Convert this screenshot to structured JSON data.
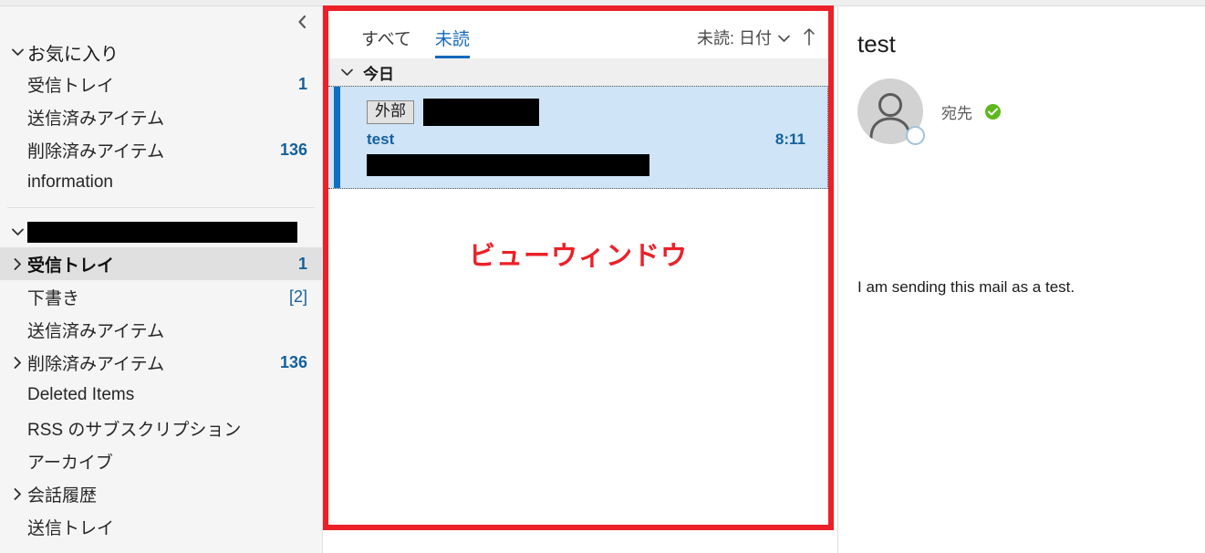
{
  "sidebar": {
    "collapse_icon": "chevron-left-icon",
    "favorites": {
      "label": "お気に入り",
      "twisty": "chevron-down-icon",
      "items": [
        {
          "label": "受信トレイ",
          "count": "1"
        },
        {
          "label": "送信済みアイテム",
          "count": ""
        },
        {
          "label": "削除済みアイテム",
          "count": "136"
        },
        {
          "label": "information",
          "count": ""
        }
      ]
    },
    "account": {
      "twisty": "chevron-down-icon",
      "name_redacted": true,
      "items": [
        {
          "label": "受信トレイ",
          "count": "1",
          "twisty": "chevron-right-icon",
          "selected": true
        },
        {
          "label": "下書き",
          "count": "[2]",
          "twisty": "",
          "selected": false
        },
        {
          "label": "送信済みアイテム",
          "count": "",
          "twisty": "",
          "selected": false
        },
        {
          "label": "削除済みアイテム",
          "count": "136",
          "twisty": "chevron-right-icon",
          "selected": false
        },
        {
          "label": "Deleted Items",
          "count": "",
          "twisty": "",
          "selected": false
        },
        {
          "label": "RSS のサブスクリプション",
          "count": "",
          "twisty": "",
          "selected": false
        },
        {
          "label": "アーカイブ",
          "count": "",
          "twisty": "",
          "selected": false
        },
        {
          "label": "会話履歴",
          "count": "",
          "twisty": "chevron-right-icon",
          "selected": false
        },
        {
          "label": "送信トレイ",
          "count": "",
          "twisty": "",
          "selected": false
        }
      ]
    }
  },
  "message_list": {
    "tabs": [
      {
        "label": "すべて",
        "active": false
      },
      {
        "label": "未読",
        "active": true
      }
    ],
    "sort": {
      "label": "未読: 日付",
      "caret_icon": "chevron-down-icon",
      "direction_icon": "arrow-up-icon"
    },
    "day_group": {
      "label": "今日",
      "twisty": "chevron-down-icon"
    },
    "message": {
      "external_tag": "外部",
      "sender_redacted": true,
      "subject": "test",
      "time": "8:11",
      "preview_redacted": true
    },
    "annotation": "ビューウィンドウ"
  },
  "reading_pane": {
    "subject": "test",
    "avatar_icon": "person-avatar-icon",
    "presence_icon": "presence-offline-icon",
    "to_label": "宛先",
    "verified_icon": "verified-check-icon",
    "body": "I am sending this mail as a test."
  },
  "colors": {
    "annotation_red": "#ec2028",
    "accent_blue": "#1569bd",
    "selection_blue": "#cfe4f7",
    "count_blue": "#15619c",
    "verified_green": "#5fb81d"
  }
}
